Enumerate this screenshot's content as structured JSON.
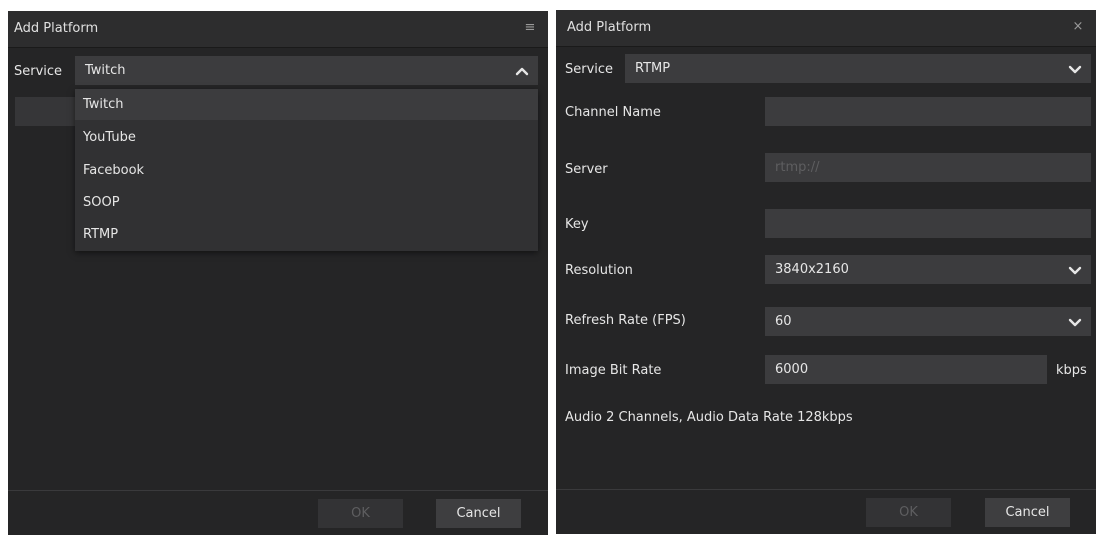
{
  "left_dialog": {
    "title": "Add Platform",
    "close_glyph": "≡",
    "service_label": "Service",
    "service_value": "Twitch",
    "dropdown_open": true,
    "options": [
      "Twitch",
      "YouTube",
      "Facebook",
      "SOOP",
      "RTMP"
    ],
    "highlighted_option": "Twitch",
    "ok_label": "OK",
    "cancel_label": "Cancel"
  },
  "right_dialog": {
    "title": "Add Platform",
    "close_glyph": "×",
    "service_label": "Service",
    "service_value": "RTMP",
    "channel_name_label": "Channel Name",
    "channel_name_value": "",
    "server_label": "Server",
    "server_placeholder": "rtmp://",
    "key_label": "Key",
    "key_value": "",
    "resolution_label": "Resolution",
    "resolution_value": "3840x2160",
    "refresh_rate_label": "Refresh Rate (FPS)",
    "refresh_rate_value": "60",
    "bitrate_label": "Image Bit Rate",
    "bitrate_value": "6000",
    "bitrate_unit": "kbps",
    "audio_info": "Audio 2 Channels, Audio Data Rate 128kbps",
    "ok_label": "OK",
    "cancel_label": "Cancel"
  },
  "colors": {
    "dialog_bg": "#252526",
    "field_bg": "#3c3c3e",
    "text": "#e6e6e6",
    "disabled_text": "#5e5e60"
  }
}
